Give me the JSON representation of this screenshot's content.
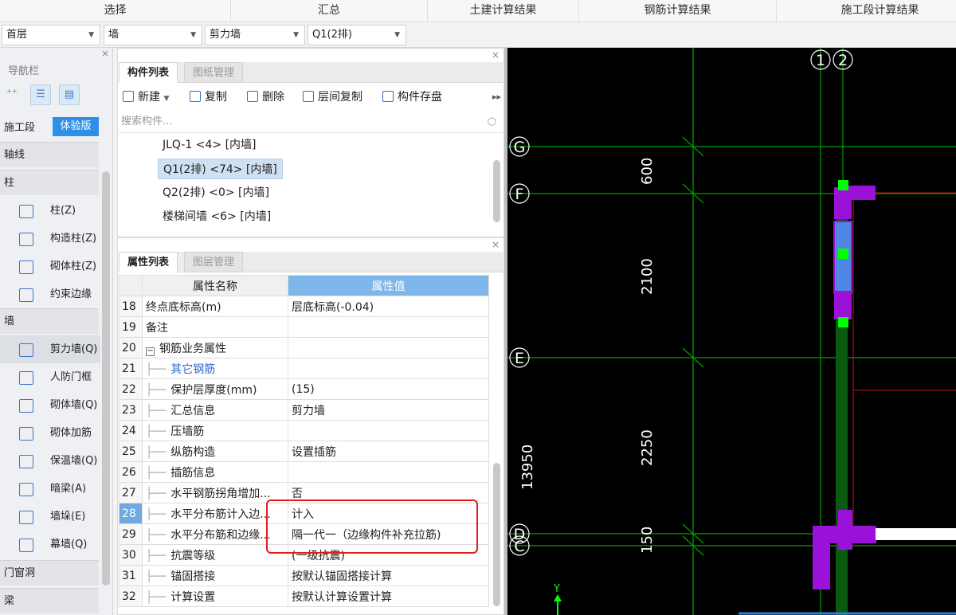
{
  "ribbon": [
    "选择",
    "汇总",
    "土建计算结果",
    "钢筋计算结果",
    "施工段计算结果"
  ],
  "toolbar": {
    "floor": "首层",
    "category": "墙",
    "type": "剪力墙",
    "component": "Q1(2排)"
  },
  "nav": {
    "title": "导航栏",
    "close": "×",
    "segment": "施工段",
    "trial": "体验版",
    "groups": {
      "axis": "轴线",
      "column": "柱",
      "wall": "墙",
      "door": "门窗洞",
      "beam": "梁"
    },
    "items": {
      "column_z": "柱(Z)",
      "gz": "构造柱(Z)",
      "masonry_col": "砌体柱(Z)",
      "edge": "约束边缘",
      "shear": "剪力墙(Q)",
      "civil_door": "人防门框",
      "masonry_wall": "砌体墙(Q)",
      "masonry_rebar": "砌体加筋",
      "insul": "保温墙(Q)",
      "hidden_beam": "暗梁(A)",
      "pier": "墙垛(E)",
      "curtain": "幕墙(Q)"
    }
  },
  "components": {
    "tabs": [
      "构件列表",
      "图纸管理"
    ],
    "toolbar": {
      "new": "新建",
      "copy": "复制",
      "delete": "删除",
      "floor_copy": "层间复制",
      "save": "构件存盘"
    },
    "search_placeholder": "搜索构件...",
    "items": [
      "JLQ-1 <4> [内墙]",
      "Q1(2排) <74> [内墙]",
      "Q2(2排) <0> [内墙]",
      "楼梯间墙 <6> [内墙]"
    ],
    "close": "×"
  },
  "properties": {
    "tabs": [
      "属性列表",
      "图层管理"
    ],
    "header": {
      "name": "属性名称",
      "value": "属性值"
    },
    "rows": [
      {
        "no": "18",
        "name": "终点底标高(m)",
        "value": "层底标高(-0.04)"
      },
      {
        "no": "19",
        "name": "备注",
        "value": ""
      },
      {
        "no": "20",
        "name": "钢筋业务属性",
        "value": ""
      },
      {
        "no": "21",
        "name": "其它钢筋",
        "value": ""
      },
      {
        "no": "22",
        "name": "保护层厚度(mm)",
        "value": "(15)"
      },
      {
        "no": "23",
        "name": "汇总信息",
        "value": "剪力墙"
      },
      {
        "no": "24",
        "name": "压墙筋",
        "value": ""
      },
      {
        "no": "25",
        "name": "纵筋构造",
        "value": "设置插筋"
      },
      {
        "no": "26",
        "name": "插筋信息",
        "value": ""
      },
      {
        "no": "27",
        "name": "水平钢筋拐角增加...",
        "value": "否"
      },
      {
        "no": "28",
        "name": "水平分布筋计入边...",
        "value": "计入"
      },
      {
        "no": "29",
        "name": "水平分布筋和边缘...",
        "value": "隔一代一（边缘构件补充拉筋)"
      },
      {
        "no": "30",
        "name": "抗震等级",
        "value": "(一级抗震)"
      },
      {
        "no": "31",
        "name": "锚固搭接",
        "value": "按默认锚固搭接计算"
      },
      {
        "no": "32",
        "name": "计算设置",
        "value": "按默认计算设置计算"
      }
    ],
    "close": "×"
  },
  "cad": {
    "axis_letters": [
      "G",
      "F",
      "E",
      "D",
      "C"
    ],
    "axis_numbers": [
      "1",
      "2"
    ],
    "dims": [
      "600",
      "2100",
      "2250",
      "150",
      "13950"
    ],
    "y_label": "Y"
  },
  "colors": {
    "canvas_bg": "#000000",
    "axis": "#00b000",
    "wall": "#9a12d8",
    "selected_wall": "#4f86e6",
    "node": "#00ff00",
    "highlight": "#e81a1a"
  }
}
